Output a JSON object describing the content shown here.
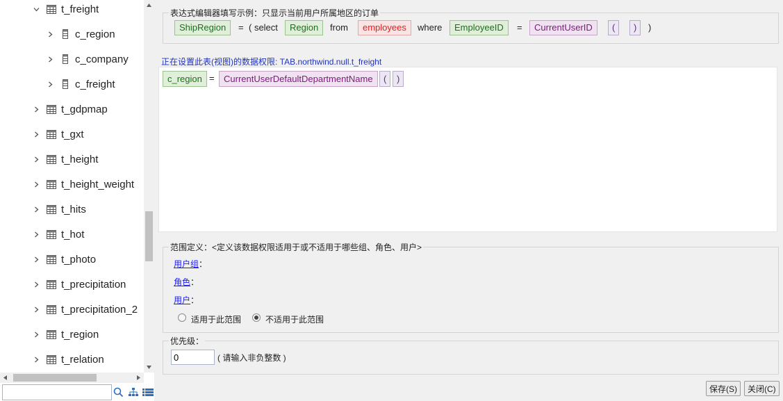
{
  "tree": {
    "rows": [
      {
        "label": "t_freight",
        "type": "table",
        "expanded": true,
        "level": 0
      },
      {
        "label": "c_region",
        "type": "column",
        "expanded": false,
        "level": 1
      },
      {
        "label": "c_company",
        "type": "column",
        "expanded": false,
        "level": 1
      },
      {
        "label": "c_freight",
        "type": "column",
        "expanded": false,
        "level": 1
      },
      {
        "label": "t_gdpmap",
        "type": "table",
        "expanded": false,
        "level": 0
      },
      {
        "label": "t_gxt",
        "type": "table",
        "expanded": false,
        "level": 0
      },
      {
        "label": "t_height",
        "type": "table",
        "expanded": false,
        "level": 0
      },
      {
        "label": "t_height_weight",
        "type": "table",
        "expanded": false,
        "level": 0
      },
      {
        "label": "t_hits",
        "type": "table",
        "expanded": false,
        "level": 0
      },
      {
        "label": "t_hot",
        "type": "table",
        "expanded": false,
        "level": 0
      },
      {
        "label": "t_photo",
        "type": "table",
        "expanded": false,
        "level": 0
      },
      {
        "label": "t_precipitation",
        "type": "table",
        "expanded": false,
        "level": 0
      },
      {
        "label": "t_precipitation_2",
        "type": "table",
        "expanded": false,
        "level": 0
      },
      {
        "label": "t_region",
        "type": "table",
        "expanded": false,
        "level": 0
      },
      {
        "label": "t_relation",
        "type": "table",
        "expanded": false,
        "level": 0
      }
    ],
    "search": {
      "value": "",
      "placeholder": ""
    },
    "icons": [
      "search-icon",
      "hierarchy-icon",
      "list-icon"
    ]
  },
  "example": {
    "legend": "表达式编辑器填写示例：只显示当前用户所属地区的订单",
    "tokens": {
      "field1": "ShipRegion",
      "eq1": "=",
      "open_select": "( select",
      "field2": "Region",
      "from": "from",
      "table": "employees",
      "where": "where",
      "field3": "EmployeeID",
      "eq2": "=",
      "func": "CurrentUserID",
      "paren_open": "(",
      "paren_close": ")",
      "close": ")"
    }
  },
  "status_line": "正在设置此表(视图)的数据权限: TAB.northwind.null.t_freight",
  "editor": {
    "tokens": {
      "field": "c_region",
      "eq": "=",
      "func": "CurrentUserDefaultDepartmentName",
      "paren_open": "(",
      "paren_close": ")"
    }
  },
  "scope": {
    "legend": "范围定义：<定义该数据权限适用于或不适用于哪些组、角色、用户>",
    "groups_link": "用户组",
    "roles_link": "角色",
    "users_link": "用户",
    "colon": "：",
    "radio_apply": "适用于此范围",
    "radio_not_apply": "不适用于此范围",
    "selected": "not_apply"
  },
  "priority": {
    "legend": "优先级：",
    "value": "0",
    "hint": "( 请输入非负整数 )"
  },
  "buttons": {
    "save": "保存(S)",
    "close": "关闭(C)"
  },
  "colors": {
    "field_text": "#1c6f1c",
    "table_text": "#e02020",
    "func_text": "#7a1a7a",
    "link": "#1a1aff",
    "status": "#2233bb"
  }
}
